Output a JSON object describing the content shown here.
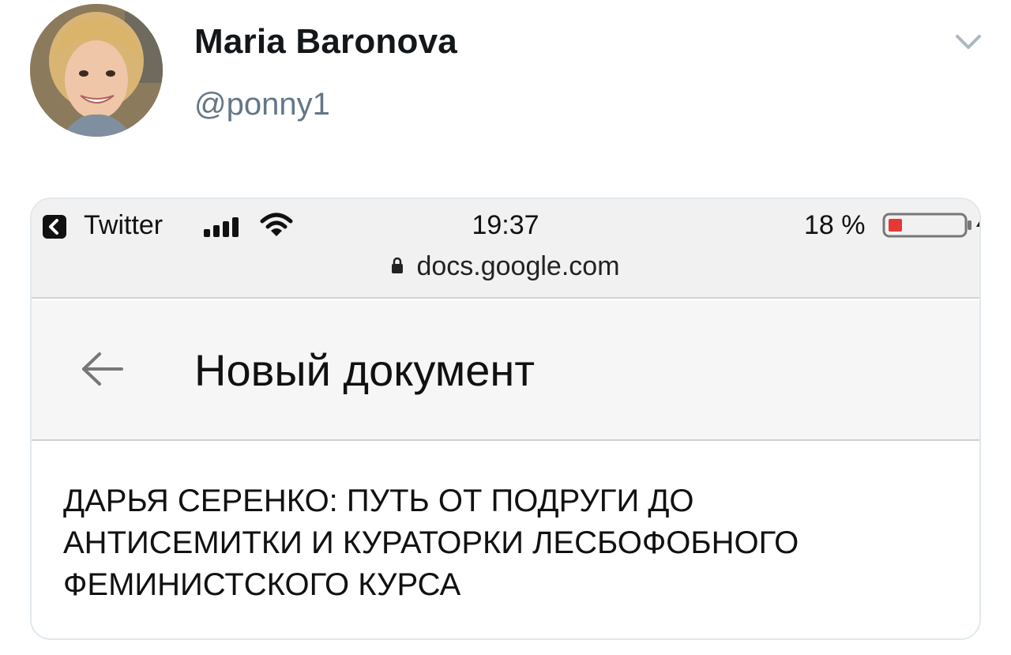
{
  "tweet": {
    "author_name": "Maria Baronova",
    "author_handle": "@ponny1",
    "avatar_icon": "user-avatar-photo",
    "menu_icon": "chevron-down-icon"
  },
  "screenshot": {
    "status_bar": {
      "back_app_label": "Twitter",
      "time": "19:37",
      "battery_percent": "18 %",
      "battery_level": 0.18,
      "battery_color": "#e53935"
    },
    "url": "docs.google.com",
    "doc_header": {
      "title": "Новый документ"
    },
    "doc_body": {
      "lines": [
        "ДАРЬЯ СЕРЕНКО: ПУТЬ ОТ ПОДРУГИ ДО",
        "АНТИСЕМИТКИ И КУРАТОРКИ ЛЕСБОФОБНОГО",
        "ФЕМИНИСТСКОГО КУРСА"
      ]
    }
  }
}
